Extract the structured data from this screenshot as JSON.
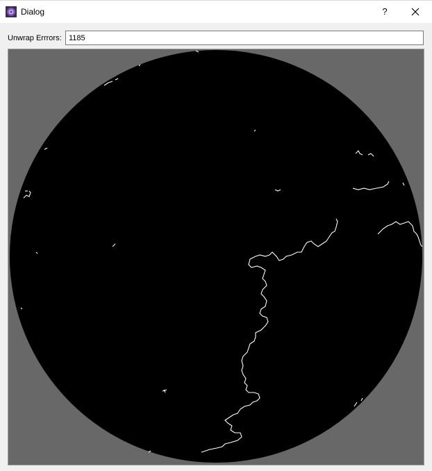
{
  "window": {
    "title": "Dialog",
    "help_label": "?",
    "icon": "app-logo-icon",
    "close_icon": "close-icon"
  },
  "form": {
    "errors_label": "Unwrap Errrors:",
    "errors_value": "1185"
  },
  "image": {
    "content": "unwrap-error-map",
    "background_color": "#686868",
    "disc_color": "#000000",
    "error_line_color": "#ffffff"
  }
}
